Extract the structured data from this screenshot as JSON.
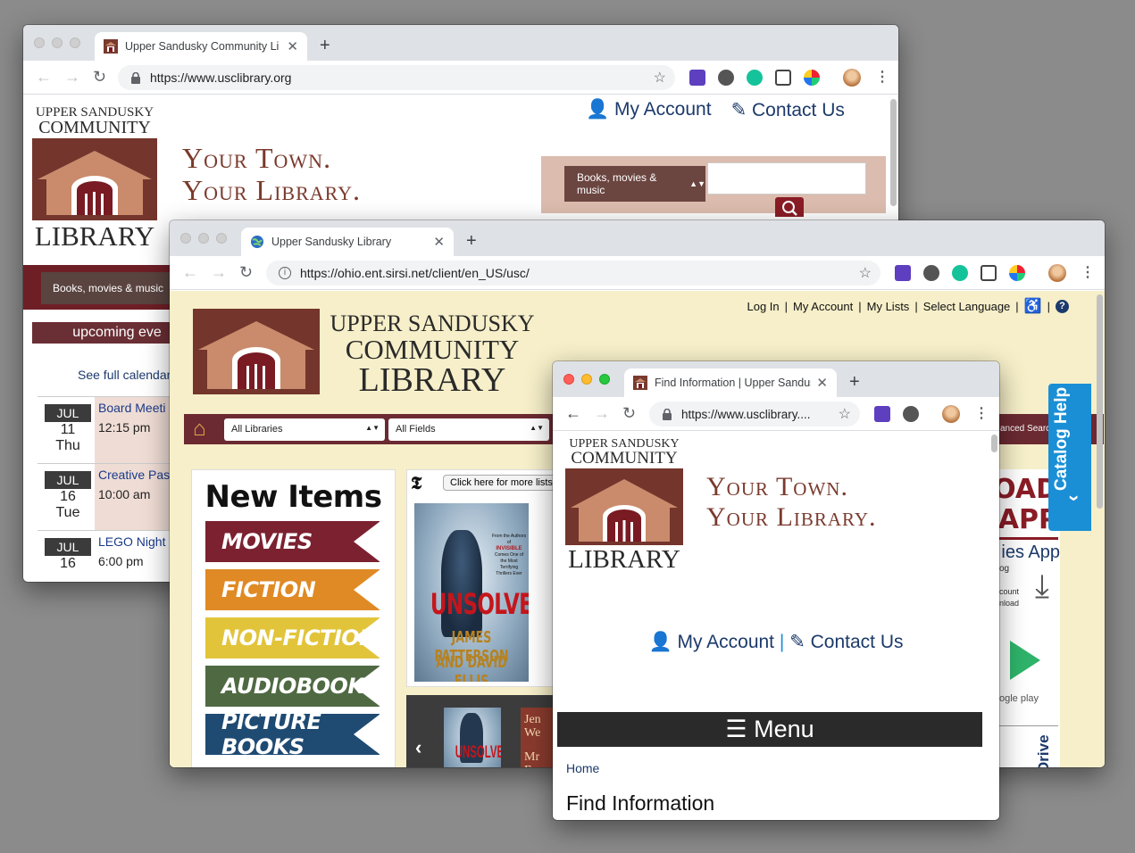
{
  "windows": {
    "usclibrary": {
      "tab_title": "Upper Sandusky Community Li",
      "url": "https://www.usclibrary.org",
      "header": {
        "my_account": "My Account",
        "contact_us": "Contact Us"
      },
      "logo": {
        "line1": "UPPER SANDUSKY",
        "line2": "COMMUNITY",
        "line3": "LIBRARY"
      },
      "slogan": {
        "line1": "Your Town.",
        "line2": "Your Library."
      },
      "search": {
        "select_value": "Books, movies & music"
      },
      "events": {
        "heading": "upcoming eve",
        "calendar_link": "See full calendar",
        "items": [
          {
            "month": "JUL",
            "day": "11",
            "weekday": "Thu",
            "title": "Board Meeti",
            "time": "12:15 pm"
          },
          {
            "month": "JUL",
            "day": "16",
            "weekday": "Tue",
            "title": "Creative Pas",
            "time": "10:00 am"
          },
          {
            "month": "JUL",
            "day": "16",
            "weekday": "",
            "title": "LEGO Night",
            "time": "6:00 pm"
          }
        ]
      }
    },
    "sirsi": {
      "tab_title": "Upper Sandusky Library",
      "url": "https://ohio.ent.sirsi.net/client/en_US/usc/",
      "top_links": [
        "Log In",
        "My Account",
        "My Lists",
        "Select Language"
      ],
      "logo": {
        "line1": "UPPER SANDUSKY",
        "line2": "COMMUNITY",
        "line3": "LIBRARY"
      },
      "search": {
        "library_select": "All Libraries",
        "field_select": "All Fields",
        "advanced": "anced Searc"
      },
      "new_items": {
        "heading": "New Items",
        "categories": [
          {
            "label": "MOVIES",
            "color": "#7b2130"
          },
          {
            "label": "FICTION",
            "color": "#e08a25"
          },
          {
            "label": "NON-FICTION",
            "color": "#e2c43a"
          },
          {
            "label": "AUDIOBOOKS",
            "color": "#4f6a43"
          },
          {
            "label": "PICTURE BOOKS",
            "color": "#1f4b73"
          }
        ]
      },
      "nyt": {
        "link": "Click here for more lists"
      },
      "book": {
        "tagline_1": "From the Authors of",
        "tagline_2": "INVISIBLE",
        "tagline_3": "Comes One of",
        "tagline_4": "the Most Terrifying",
        "tagline_5": "Thrillers Ever",
        "title": "UNSOLVED",
        "author_1": "JAMES PATTERSON",
        "author_2": "AND DAVID ELLIS"
      },
      "carousel": {
        "next_cover_line1": "Jen",
        "next_cover_line2": "We",
        "next_cover_line3": "Mr",
        "next_cover_line4": "Ev"
      },
      "app_promo": {
        "big1": "OAD",
        "big2": "APP",
        "line1": "ies App",
        "line2": "og",
        "line3": "count",
        "line4": "nload",
        "store": "ogle play",
        "side": "Drive"
      },
      "catalog_help": "Catalog Help"
    },
    "find_info": {
      "tab_title": "Find Information | Upper Sandus",
      "url": "https://www.usclibrary....",
      "logo": {
        "line1": "UPPER SANDUSKY",
        "line2": "COMMUNITY",
        "line3": "LIBRARY"
      },
      "slogan": {
        "line1": "Your Town.",
        "line2": "Your Library."
      },
      "my_account": "My Account",
      "separator": "|",
      "contact_us": "Contact Us",
      "menu": "Menu",
      "breadcrumb": "Home",
      "page_title": "Find Information"
    }
  },
  "colors": {
    "maroon": "#6e1f26",
    "brick": "#7a3a2d",
    "navy": "#1c3a6b",
    "cream": "#f6efc9",
    "catalog_blue": "#1a8fd5"
  }
}
